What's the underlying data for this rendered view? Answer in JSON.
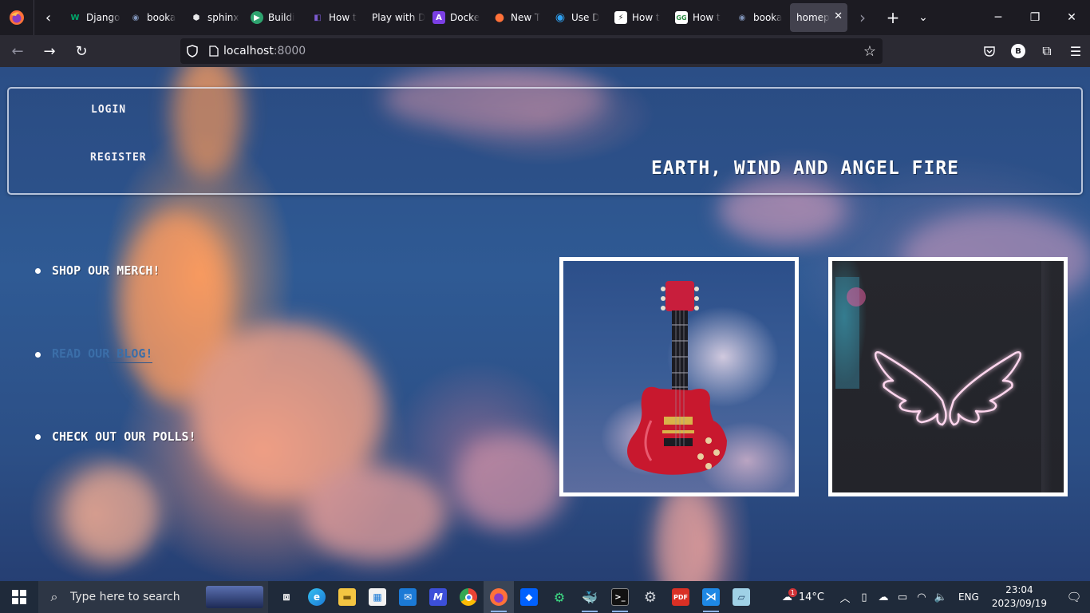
{
  "browser": {
    "tabs": [
      {
        "label": "Django",
        "fav_text": "W",
        "fav_color": "#00a86b"
      },
      {
        "label": "booka",
        "fav_text": "◉",
        "fav_color": "#3a4a66"
      },
      {
        "label": "sphinx",
        "fav_text": "⬢",
        "fav_color": "#cfd3da"
      },
      {
        "label": "Buildi",
        "fav_text": "▶",
        "fav_color": "#2ea36f"
      },
      {
        "label": "How t",
        "fav_text": "◧",
        "fav_color": "#5b3fa0"
      },
      {
        "label": "Play with D",
        "fav_text": "",
        "fav_color": "transparent"
      },
      {
        "label": "Docke",
        "fav_text": "A",
        "fav_color": "#7b3fe4"
      },
      {
        "label": "New T",
        "fav_text": "●",
        "fav_color": "#ff7139"
      },
      {
        "label": "Use D",
        "fav_text": "◉",
        "fav_color": "#1a73e8"
      },
      {
        "label": "How t",
        "fav_text": "⚡",
        "fav_color": "#ffffff"
      },
      {
        "label": "How t",
        "fav_text": "GG",
        "fav_color": "#2f8d46"
      },
      {
        "label": "booka",
        "fav_text": "◉",
        "fav_color": "#3a4a66"
      }
    ],
    "active_tab": {
      "label": "homep"
    },
    "url_host": "localhost",
    "url_port": ":8000",
    "profile_initial": "B"
  },
  "page": {
    "login_label": "LOGIN",
    "register_label": "REGISTER",
    "site_title": "EARTH, WIND AND ANGEL FIRE",
    "menu": [
      {
        "label": "SHOP OUR MERCH!"
      },
      {
        "label": "READ OUR BLOG!"
      },
      {
        "label": "CHECK OUT OUR POLLS!"
      }
    ]
  },
  "taskbar": {
    "search_placeholder": "Type here to search",
    "weather": "14°C",
    "language": "ENG",
    "time": "23:04",
    "date": "2023/09/19",
    "notification_count": "1"
  }
}
